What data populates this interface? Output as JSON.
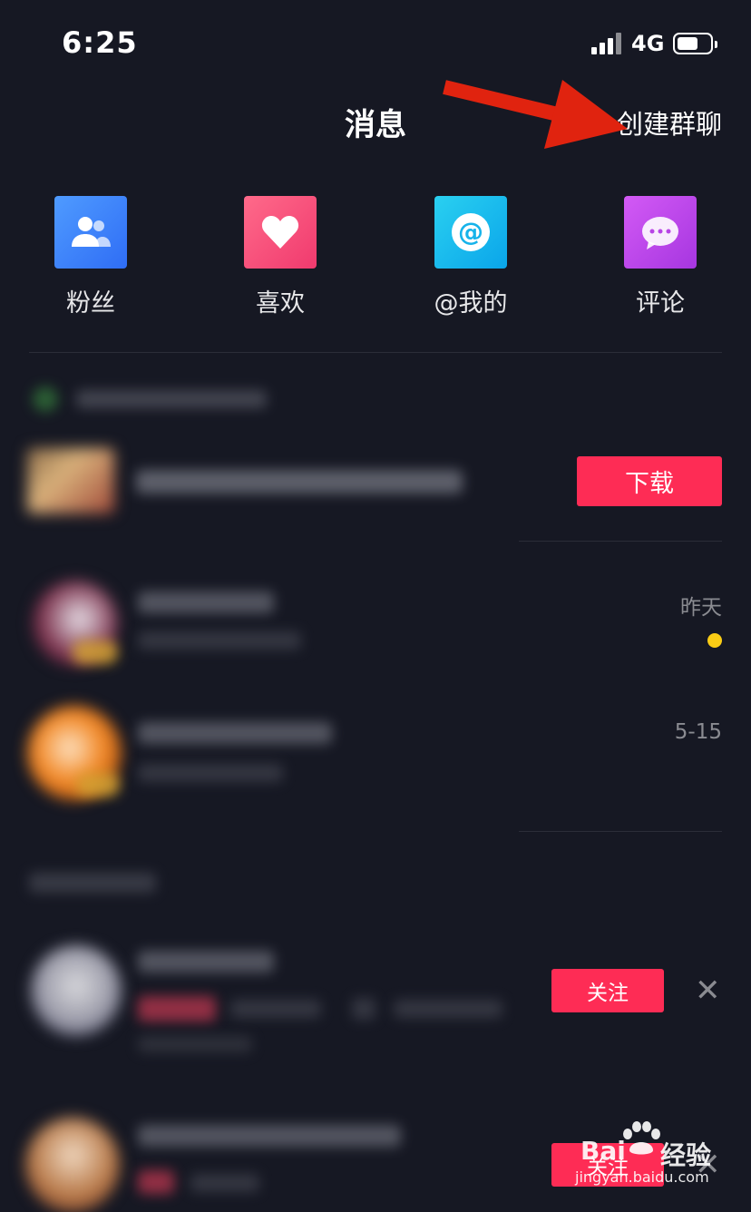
{
  "status_bar": {
    "time": "6:25",
    "network": "4G"
  },
  "header": {
    "title": "消息",
    "create_group": "创建群聊"
  },
  "categories": [
    {
      "label": "粉丝",
      "icon": "fans-icon",
      "color": "#3b82f6"
    },
    {
      "label": "喜欢",
      "icon": "heart-icon",
      "color": "#fb4a7c"
    },
    {
      "label": "@我的",
      "icon": "at-icon",
      "color": "#14b8e6"
    },
    {
      "label": "评论",
      "icon": "comment-icon",
      "color": "#c04ae8"
    }
  ],
  "ad": {
    "download_label": "下载"
  },
  "conversations": [
    {
      "time": "昨天",
      "unread": true
    },
    {
      "time": "5-15",
      "unread": false
    }
  ],
  "recommendations": [
    {
      "follow_label": "关注"
    },
    {
      "follow_label": "关注"
    }
  ],
  "watermark": {
    "brand": "Bai",
    "brand2": "经验",
    "url": "jingyan.baidu.com"
  },
  "colors": {
    "background": "#161823",
    "accent": "#fe2c55",
    "unread_dot": "#facc15"
  }
}
